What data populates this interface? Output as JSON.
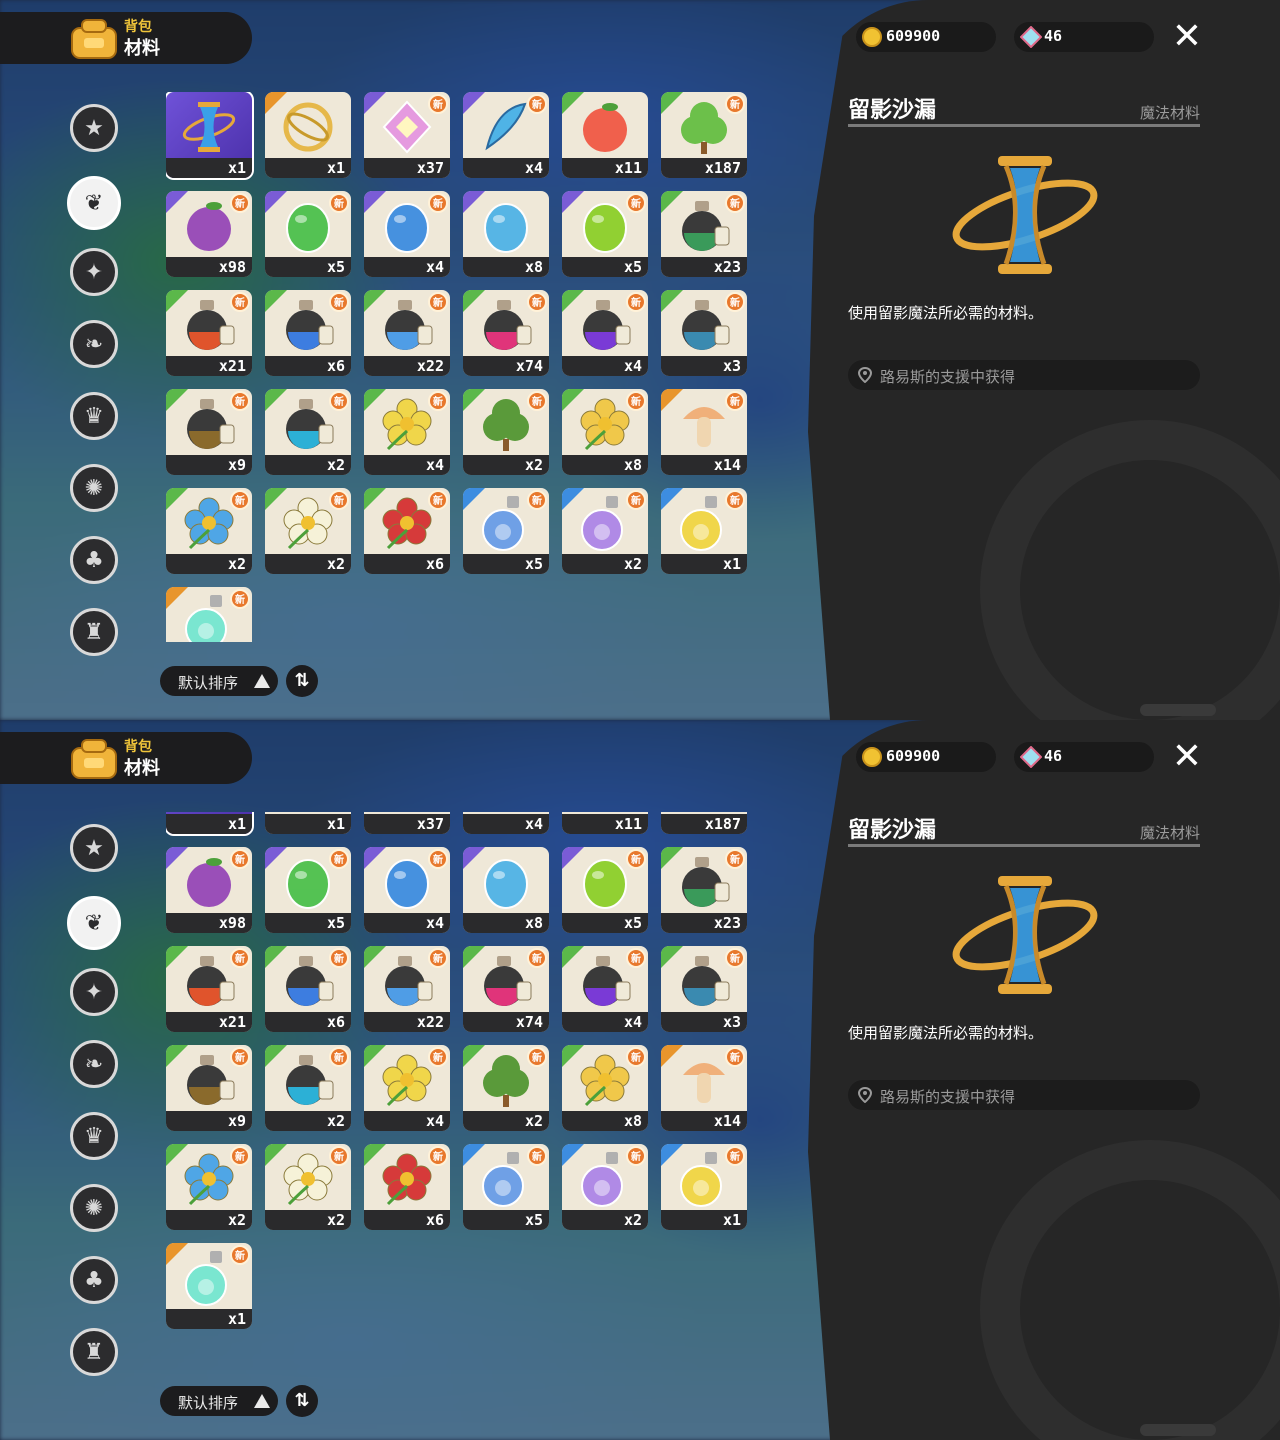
{
  "header": {
    "sub": "背包",
    "title": "材料"
  },
  "nav": [
    "star-circle-icon",
    "flame-leaf-icon",
    "sparkle-badge-icon",
    "leaf-cluster-icon",
    "scroll-crown-icon",
    "orb-stars-icon",
    "acorn-icon",
    "furniture-icon"
  ],
  "sort": {
    "label": "默认排序"
  },
  "currency": {
    "gold": "609900",
    "gem": "46"
  },
  "detail": {
    "name": "留影沙漏",
    "type": "魔法材料",
    "description": "使用留影魔法所必需的材料。",
    "source": "路易斯的支援中获得"
  },
  "items": [
    {
      "name": "hourglass-item",
      "count": "x1",
      "rarity": "purple",
      "new": false,
      "color": "#3aa0e8",
      "shape": "hourglass",
      "selected": true
    },
    {
      "name": "golden-ring-item",
      "count": "x1",
      "rarity": "orange",
      "new": false,
      "color": "#e6b84a",
      "shape": "ring"
    },
    {
      "name": "rainbow-crystal-item",
      "count": "x37",
      "rarity": "purple",
      "new": true,
      "color": "#e59adf",
      "shape": "diamond"
    },
    {
      "name": "blue-feather-item",
      "count": "x4",
      "rarity": "purple",
      "new": true,
      "color": "#4fb3e6",
      "shape": "feather"
    },
    {
      "name": "peach-item",
      "count": "x11",
      "rarity": "green",
      "new": false,
      "color": "#f0604c",
      "shape": "round"
    },
    {
      "name": "green-plant-item",
      "count": "x187",
      "rarity": "green",
      "new": true,
      "color": "#6cc04a",
      "shape": "bush"
    },
    {
      "name": "purple-fruit-item",
      "count": "x98",
      "rarity": "purple",
      "new": true,
      "color": "#9a4fb8",
      "shape": "round"
    },
    {
      "name": "green-leaf-egg-item",
      "count": "x5",
      "rarity": "purple",
      "new": true,
      "color": "#4cc04c",
      "shape": "egg"
    },
    {
      "name": "blue-drop-egg-item",
      "count": "x4",
      "rarity": "purple",
      "new": true,
      "color": "#3d8de0",
      "shape": "egg"
    },
    {
      "name": "blue-star-egg-item",
      "count": "x8",
      "rarity": "purple",
      "new": false,
      "color": "#4fb3e6",
      "shape": "egg"
    },
    {
      "name": "lime-egg-item",
      "count": "x5",
      "rarity": "purple",
      "new": true,
      "color": "#8ccf2a",
      "shape": "egg"
    },
    {
      "name": "green-potion-item",
      "count": "x23",
      "rarity": "green",
      "new": true,
      "color": "#3a9a5a",
      "shape": "potion"
    },
    {
      "name": "red-potion-item",
      "count": "x21",
      "rarity": "green",
      "new": true,
      "color": "#e0542c",
      "shape": "potion"
    },
    {
      "name": "blue-potion-item",
      "count": "x6",
      "rarity": "green",
      "new": true,
      "color": "#3d7de0",
      "shape": "potion"
    },
    {
      "name": "sky-potion-item",
      "count": "x22",
      "rarity": "green",
      "new": true,
      "color": "#4f9de6",
      "shape": "potion"
    },
    {
      "name": "pink-potion-item",
      "count": "x74",
      "rarity": "green",
      "new": true,
      "color": "#e0347a",
      "shape": "potion"
    },
    {
      "name": "violet-potion-item",
      "count": "x4",
      "rarity": "green",
      "new": true,
      "color": "#7a3ad6",
      "shape": "potion"
    },
    {
      "name": "teal-potion-item",
      "count": "x3",
      "rarity": "green",
      "new": true,
      "color": "#3a8ab0",
      "shape": "potion"
    },
    {
      "name": "brown-potion-item",
      "count": "x9",
      "rarity": "green",
      "new": true,
      "color": "#8a6a2c",
      "shape": "potion"
    },
    {
      "name": "cyan-potion-item",
      "count": "x2",
      "rarity": "green",
      "new": true,
      "color": "#2cb0d6",
      "shape": "potion"
    },
    {
      "name": "yellow-flower-item",
      "count": "x4",
      "rarity": "green",
      "new": true,
      "color": "#f0d64a",
      "shape": "flower"
    },
    {
      "name": "green-bud-item",
      "count": "x2",
      "rarity": "green",
      "new": true,
      "color": "#5a9a3a",
      "shape": "bush"
    },
    {
      "name": "lily-item",
      "count": "x8",
      "rarity": "green",
      "new": true,
      "color": "#f0c84a",
      "shape": "flower"
    },
    {
      "name": "mushroom-item",
      "count": "x14",
      "rarity": "orange",
      "new": true,
      "color": "#f0b07a",
      "shape": "mushroom"
    },
    {
      "name": "blue-flower-item",
      "count": "x2",
      "rarity": "green",
      "new": true,
      "color": "#4fa6e6",
      "shape": "flower"
    },
    {
      "name": "white-flower-item",
      "count": "x2",
      "rarity": "green",
      "new": true,
      "color": "#f6f2d8",
      "shape": "flower"
    },
    {
      "name": "red-flower-item",
      "count": "x6",
      "rarity": "green",
      "new": true,
      "color": "#d63a3a",
      "shape": "flower"
    },
    {
      "name": "blue-bottle-item",
      "count": "x5",
      "rarity": "blue",
      "new": true,
      "color": "#6fa0e6",
      "shape": "bottle"
    },
    {
      "name": "lavender-bottle-item",
      "count": "x2",
      "rarity": "blue",
      "new": true,
      "color": "#b08ae6",
      "shape": "bottle"
    },
    {
      "name": "gold-bottle-item",
      "count": "x1",
      "rarity": "blue",
      "new": true,
      "color": "#f0d64a",
      "shape": "bottle"
    },
    {
      "name": "mint-bottle-item",
      "count": "x1",
      "rarity": "orange",
      "new": true,
      "color": "#7ae6d0",
      "shape": "bottle"
    }
  ]
}
